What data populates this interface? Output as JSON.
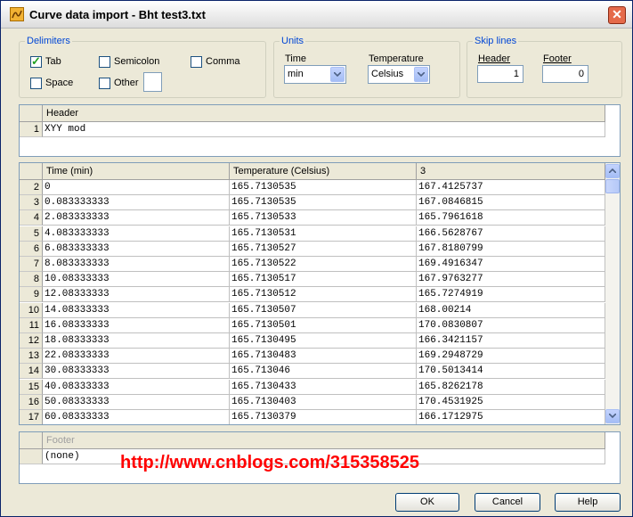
{
  "window": {
    "title": "Curve data import - Bht test3.txt",
    "icon": "curve-import-icon",
    "close_glyph": "✕"
  },
  "delimiters": {
    "legend": "Delimiters",
    "tab": {
      "label": "Tab",
      "checked": true
    },
    "semicolon": {
      "label": "Semicolon",
      "checked": false
    },
    "comma": {
      "label": "Comma",
      "checked": false
    },
    "space": {
      "label": "Space",
      "checked": false
    },
    "other": {
      "label": "Other",
      "checked": false,
      "value": ""
    }
  },
  "units": {
    "legend": "Units",
    "time_label": "Time",
    "time_value": "min",
    "temperature_label": "Temperature",
    "temperature_value": "Celsius"
  },
  "skip_lines": {
    "legend": "Skip lines",
    "header_label": "Header",
    "header_value": "1",
    "footer_label": "Footer",
    "footer_value": "0"
  },
  "header_grid": {
    "column": "Header",
    "rows": [
      {
        "num": "1",
        "text": "XYY mod"
      }
    ]
  },
  "data_grid": {
    "columns": [
      "Time (min)",
      "Temperature (Celsius)",
      "3"
    ],
    "rows": [
      {
        "num": "2",
        "c1": "0",
        "c2": "165.7130535",
        "c3": "167.4125737"
      },
      {
        "num": "3",
        "c1": "0.083333333",
        "c2": "165.7130535",
        "c3": "167.0846815"
      },
      {
        "num": "4",
        "c1": "2.083333333",
        "c2": "165.7130533",
        "c3": "165.7961618"
      },
      {
        "num": "5",
        "c1": "4.083333333",
        "c2": "165.7130531",
        "c3": "166.5628767"
      },
      {
        "num": "6",
        "c1": "6.083333333",
        "c2": "165.7130527",
        "c3": "167.8180799"
      },
      {
        "num": "7",
        "c1": "8.083333333",
        "c2": "165.7130522",
        "c3": "169.4916347"
      },
      {
        "num": "8",
        "c1": "10.08333333",
        "c2": "165.7130517",
        "c3": "167.9763277"
      },
      {
        "num": "9",
        "c1": "12.08333333",
        "c2": "165.7130512",
        "c3": "165.7274919"
      },
      {
        "num": "10",
        "c1": "14.08333333",
        "c2": "165.7130507",
        "c3": "168.00214"
      },
      {
        "num": "11",
        "c1": "16.08333333",
        "c2": "165.7130501",
        "c3": "170.0830807"
      },
      {
        "num": "12",
        "c1": "18.08333333",
        "c2": "165.7130495",
        "c3": "166.3421157"
      },
      {
        "num": "13",
        "c1": "22.08333333",
        "c2": "165.7130483",
        "c3": "169.2948729"
      },
      {
        "num": "14",
        "c1": "30.08333333",
        "c2": "165.713046",
        "c3": "170.5013414"
      },
      {
        "num": "15",
        "c1": "40.08333333",
        "c2": "165.7130433",
        "c3": "165.8262178"
      },
      {
        "num": "16",
        "c1": "50.08333333",
        "c2": "165.7130403",
        "c3": "170.4531925"
      },
      {
        "num": "17",
        "c1": "60.08333333",
        "c2": "165.7130379",
        "c3": "166.1712975"
      }
    ]
  },
  "footer_grid": {
    "column": "Footer",
    "rows": [
      {
        "text": "(none)"
      }
    ]
  },
  "watermark": "http://www.cnblogs.com/315358525",
  "buttons": {
    "ok": "OK",
    "cancel": "Cancel",
    "help": "Help"
  },
  "colors": {
    "legend": "#0046d5",
    "watermark": "#ff0000",
    "close": "#e56a4a"
  }
}
